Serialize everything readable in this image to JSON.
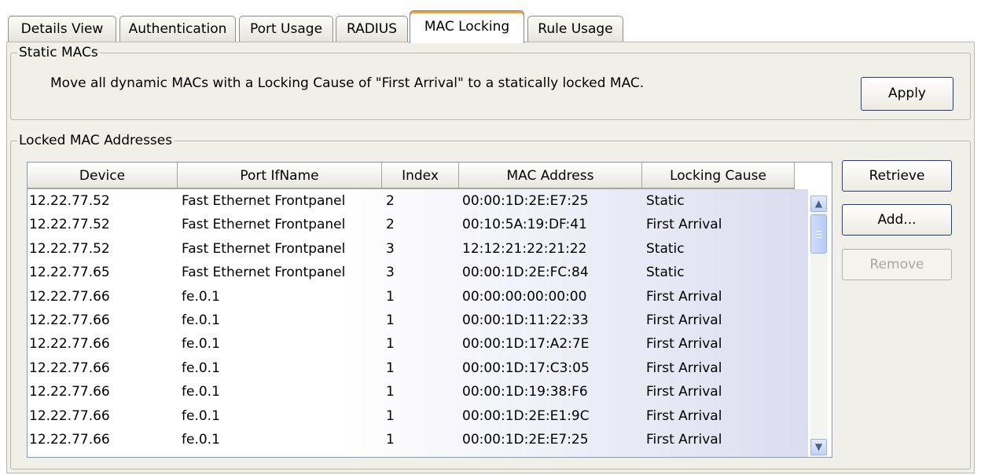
{
  "tabs": [
    {
      "label": "Details View",
      "active": false
    },
    {
      "label": "Authentication",
      "active": false
    },
    {
      "label": "Port Usage",
      "active": false
    },
    {
      "label": "RADIUS",
      "active": false
    },
    {
      "label": "MAC Locking",
      "active": true
    },
    {
      "label": "Rule Usage",
      "active": false
    }
  ],
  "static_macs": {
    "title": "Static MACs",
    "message": "Move all dynamic MACs with a Locking Cause of \"First Arrival\" to a statically locked MAC.",
    "apply_label": "Apply"
  },
  "locked": {
    "title": "Locked MAC Addresses",
    "columns": [
      "Device",
      "Port IfName",
      "Index",
      "MAC Address",
      "Locking Cause"
    ],
    "rows": [
      [
        "12.22.77.52",
        "Fast Ethernet Frontpanel",
        "2",
        "00:00:1D:2E:E7:25",
        "Static"
      ],
      [
        "12.22.77.52",
        "Fast Ethernet Frontpanel",
        "2",
        "00:10:5A:19:DF:41",
        "First Arrival"
      ],
      [
        "12.22.77.52",
        "Fast Ethernet Frontpanel",
        "3",
        "12:12:21:22:21:22",
        "Static"
      ],
      [
        "12.22.77.65",
        "Fast Ethernet Frontpanel",
        "3",
        "00:00:1D:2E:FC:84",
        "Static"
      ],
      [
        "12.22.77.66",
        "fe.0.1",
        "1",
        "00:00:00:00:00:00",
        "First Arrival"
      ],
      [
        "12.22.77.66",
        "fe.0.1",
        "1",
        "00:00:1D:11:22:33",
        "First Arrival"
      ],
      [
        "12.22.77.66",
        "fe.0.1",
        "1",
        "00:00:1D:17:A2:7E",
        "First Arrival"
      ],
      [
        "12.22.77.66",
        "fe.0.1",
        "1",
        "00:00:1D:17:C3:05",
        "First Arrival"
      ],
      [
        "12.22.77.66",
        "fe.0.1",
        "1",
        "00:00:1D:19:38:F6",
        "First Arrival"
      ],
      [
        "12.22.77.66",
        "fe.0.1",
        "1",
        "00:00:1D:2E:E1:9C",
        "First Arrival"
      ],
      [
        "12.22.77.66",
        "fe.0.1",
        "1",
        "00:00:1D:2E:E7:25",
        "First Arrival"
      ]
    ],
    "buttons": {
      "retrieve": "Retrieve",
      "add": "Add...",
      "remove": "Remove"
    }
  },
  "icons": {
    "scroll_up": "scroll-up-arrow-icon",
    "scroll_down": "scroll-down-arrow-icon"
  },
  "colors": {
    "active_tab_accent": "#f0a030",
    "button_border": "#1c3f94",
    "panel_background": "#f0efe8"
  }
}
